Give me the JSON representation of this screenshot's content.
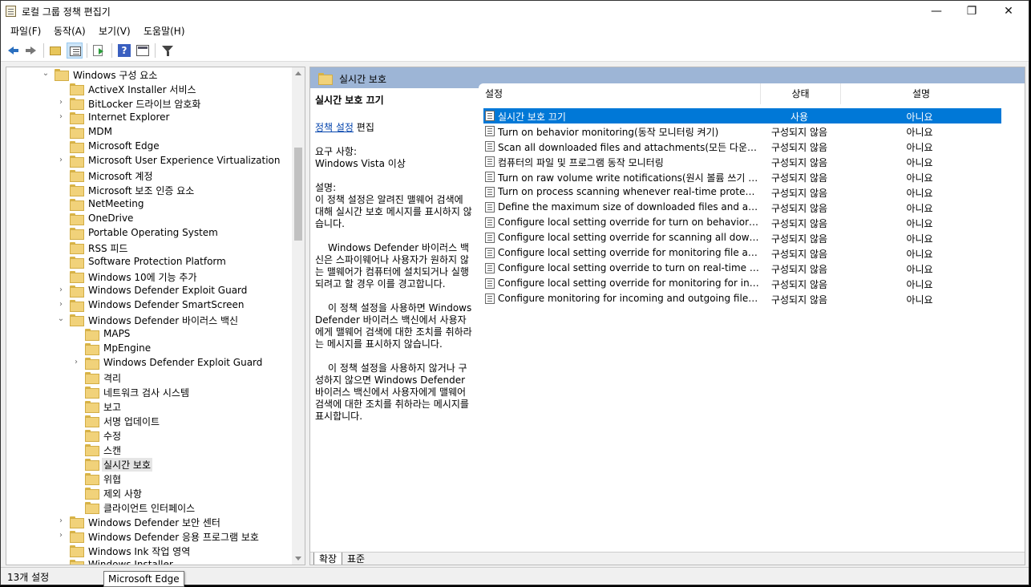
{
  "window": {
    "title": "로컬 그룹 정책 편집기",
    "minimize": "—",
    "maximize": "❐",
    "close": "✕"
  },
  "menu": [
    "파일(F)",
    "동작(A)",
    "보기(V)",
    "도움말(H)"
  ],
  "toolbar": {
    "icons": [
      "back-icon",
      "forward-icon",
      "up-folder-icon",
      "show-hide-tree-icon",
      "export-list-icon",
      "help-icon",
      "console-icon",
      "filter-icon"
    ]
  },
  "tree": {
    "items": [
      {
        "label": "Windows 구성 요소",
        "expander": "⌄",
        "level": 0
      },
      {
        "label": "ActiveX Installer 서비스",
        "expander": "",
        "level": 1
      },
      {
        "label": "BitLocker 드라이브 암호화",
        "expander": "›",
        "level": 1
      },
      {
        "label": "Internet Explorer",
        "expander": "›",
        "level": 1
      },
      {
        "label": "MDM",
        "expander": "",
        "level": 1
      },
      {
        "label": "Microsoft Edge",
        "expander": "",
        "level": 1
      },
      {
        "label": "Microsoft User Experience Virtualization",
        "expander": "›",
        "level": 1
      },
      {
        "label": "Microsoft 계정",
        "expander": "",
        "level": 1
      },
      {
        "label": "Microsoft 보조 인증 요소",
        "expander": "",
        "level": 1
      },
      {
        "label": "NetMeeting",
        "expander": "",
        "level": 1
      },
      {
        "label": "OneDrive",
        "expander": "",
        "level": 1
      },
      {
        "label": "Portable Operating System",
        "expander": "",
        "level": 1
      },
      {
        "label": "RSS 피드",
        "expander": "",
        "level": 1
      },
      {
        "label": "Software Protection Platform",
        "expander": "",
        "level": 1
      },
      {
        "label": "Windows 10에 기능 추가",
        "expander": "",
        "level": 1
      },
      {
        "label": "Windows Defender Exploit Guard",
        "expander": "›",
        "level": 1
      },
      {
        "label": "Windows Defender SmartScreen",
        "expander": "›",
        "level": 1
      },
      {
        "label": "Windows Defender 바이러스 백신",
        "expander": "⌄",
        "level": 1
      },
      {
        "label": "MAPS",
        "expander": "",
        "level": 2
      },
      {
        "label": "MpEngine",
        "expander": "",
        "level": 2
      },
      {
        "label": "Windows Defender Exploit Guard",
        "expander": "›",
        "level": 2
      },
      {
        "label": "격리",
        "expander": "",
        "level": 2
      },
      {
        "label": "네트워크 검사 시스템",
        "expander": "",
        "level": 2
      },
      {
        "label": "보고",
        "expander": "",
        "level": 2
      },
      {
        "label": "서명 업데이트",
        "expander": "",
        "level": 2
      },
      {
        "label": "수정",
        "expander": "",
        "level": 2
      },
      {
        "label": "스캔",
        "expander": "",
        "level": 2
      },
      {
        "label": "실시간 보호",
        "expander": "",
        "level": 2,
        "selected": true
      },
      {
        "label": "위협",
        "expander": "",
        "level": 2
      },
      {
        "label": "제외 사항",
        "expander": "",
        "level": 2
      },
      {
        "label": "클라이언트 인터페이스",
        "expander": "",
        "level": 2
      },
      {
        "label": "Windows Defender 보안 센터",
        "expander": "›",
        "level": 1
      },
      {
        "label": "Windows Defender 응용 프로그램 보호",
        "expander": "›",
        "level": 1
      },
      {
        "label": "Windows Ink 작업 영역",
        "expander": "",
        "level": 1
      },
      {
        "label": "Windows Installer",
        "expander": "",
        "level": 1
      }
    ]
  },
  "detail": {
    "header": "실시간 보호",
    "policy_title": "실시간 보호 끄기",
    "edit_link": "정책 설정",
    "edit_suffix": " 편집",
    "req_label": "요구 사항:",
    "req_value": "Windows Vista 이상",
    "desc_label": "설명:",
    "desc_p1": "이 정책 설정은 알려진 맬웨어 검색에 대해 실시간 보호 메시지를 표시하지 않습니다.",
    "desc_p2": "Windows Defender 바이러스 백신은 스파이웨어나 사용자가 원하지 않는 맬웨어가 컴퓨터에 설치되거나 실행되려고 할 경우 이를 경고합니다.",
    "desc_p3": "이 정책 설정을 사용하면 Windows Defender 바이러스 백신에서 사용자에게 맬웨어 검색에 대한 조치를 취하라는 메시지를 표시하지 않습니다.",
    "desc_p4": "이 정책 설정을 사용하지 않거나 구성하지 않으면 Windows Defender 바이러스 백신에서 사용자에게 맬웨어 검색에 대한 조치를 취하라는 메시지를 표시합니다."
  },
  "list": {
    "columns": [
      "설정",
      "상태",
      "설명"
    ],
    "rows": [
      {
        "setting": "실시간 보호 끄기",
        "state": "사용",
        "comment": "아니요",
        "selected": true
      },
      {
        "setting": "Turn on behavior monitoring(동작 모니터링 켜기)",
        "state": "구성되지 않음",
        "comment": "아니요"
      },
      {
        "setting": "Scan all downloaded files and attachments(모든 다운로드한 파일 및 첨부 파일 검색)",
        "state": "구성되지 않음",
        "comment": "아니요"
      },
      {
        "setting": "컴퓨터의 파일 및 프로그램 동작 모니터링",
        "state": "구성되지 않음",
        "comment": "아니요"
      },
      {
        "setting": "Turn on raw volume write notifications(원시 볼륨 쓰기 알림 켜기)",
        "state": "구성되지 않음",
        "comment": "아니요"
      },
      {
        "setting": "Turn on process scanning whenever real-time protection is enabled",
        "state": "구성되지 않음",
        "comment": "아니요"
      },
      {
        "setting": "Define the maximum size of downloaded files and attachments to be scanned",
        "state": "구성되지 않음",
        "comment": "아니요"
      },
      {
        "setting": "Configure local setting override for turn on behavior monitoring",
        "state": "구성되지 않음",
        "comment": "아니요"
      },
      {
        "setting": "Configure local setting override for scanning all downloaded files and attachments",
        "state": "구성되지 않음",
        "comment": "아니요"
      },
      {
        "setting": "Configure local setting override for monitoring file and program activity",
        "state": "구성되지 않음",
        "comment": "아니요"
      },
      {
        "setting": "Configure local setting override to turn on real-time protection",
        "state": "구성되지 않음",
        "comment": "아니요"
      },
      {
        "setting": "Configure local setting override for monitoring for incoming and outgoing file activity",
        "state": "구성되지 않음",
        "comment": "아니요"
      },
      {
        "setting": "Configure monitoring for incoming and outgoing file and program activity",
        "state": "구성되지 않음",
        "comment": "아니요"
      }
    ]
  },
  "tabs": [
    "확장",
    "표준"
  ],
  "status": "13개 설정",
  "tooltip": "Microsoft Edge"
}
